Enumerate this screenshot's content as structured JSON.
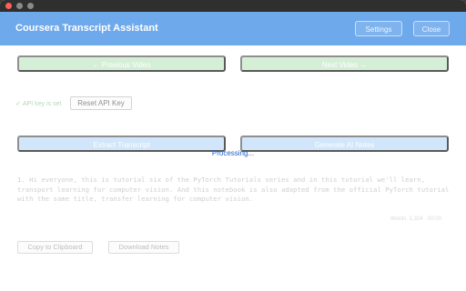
{
  "window": {
    "title": ""
  },
  "header": {
    "title": "Coursera Transcript Assistant",
    "settings_label": "Settings",
    "close_label": "Close"
  },
  "nav": {
    "prev_label": "← Previous Video",
    "next_label": "Next Video →"
  },
  "api": {
    "status": "API key is set",
    "reset_label": "Reset API Key"
  },
  "actions": {
    "extract_label": "Extract Transcript",
    "generate_label": "Generate AI Notes"
  },
  "status": {
    "processing": "Processing..."
  },
  "transcript": {
    "text": "1. Hi everyone, this is tutorial six of the PyTorch Tutorials series and in this tutorial we'll learn, transport learning for computer vision. And this notebook is also adapted from the official PyTorch tutorial with the same title, transfer learning for computer vision.",
    "meta": "Words: 1,324 · 00:00"
  },
  "footer": {
    "copy_label": "Copy to Clipboard",
    "download_label": "Download Notes"
  },
  "colors": {
    "header": "#1f7be0",
    "nav_button": "#bfe7c2",
    "action_button": "#b9d9f7",
    "processing": "#2060c8"
  }
}
